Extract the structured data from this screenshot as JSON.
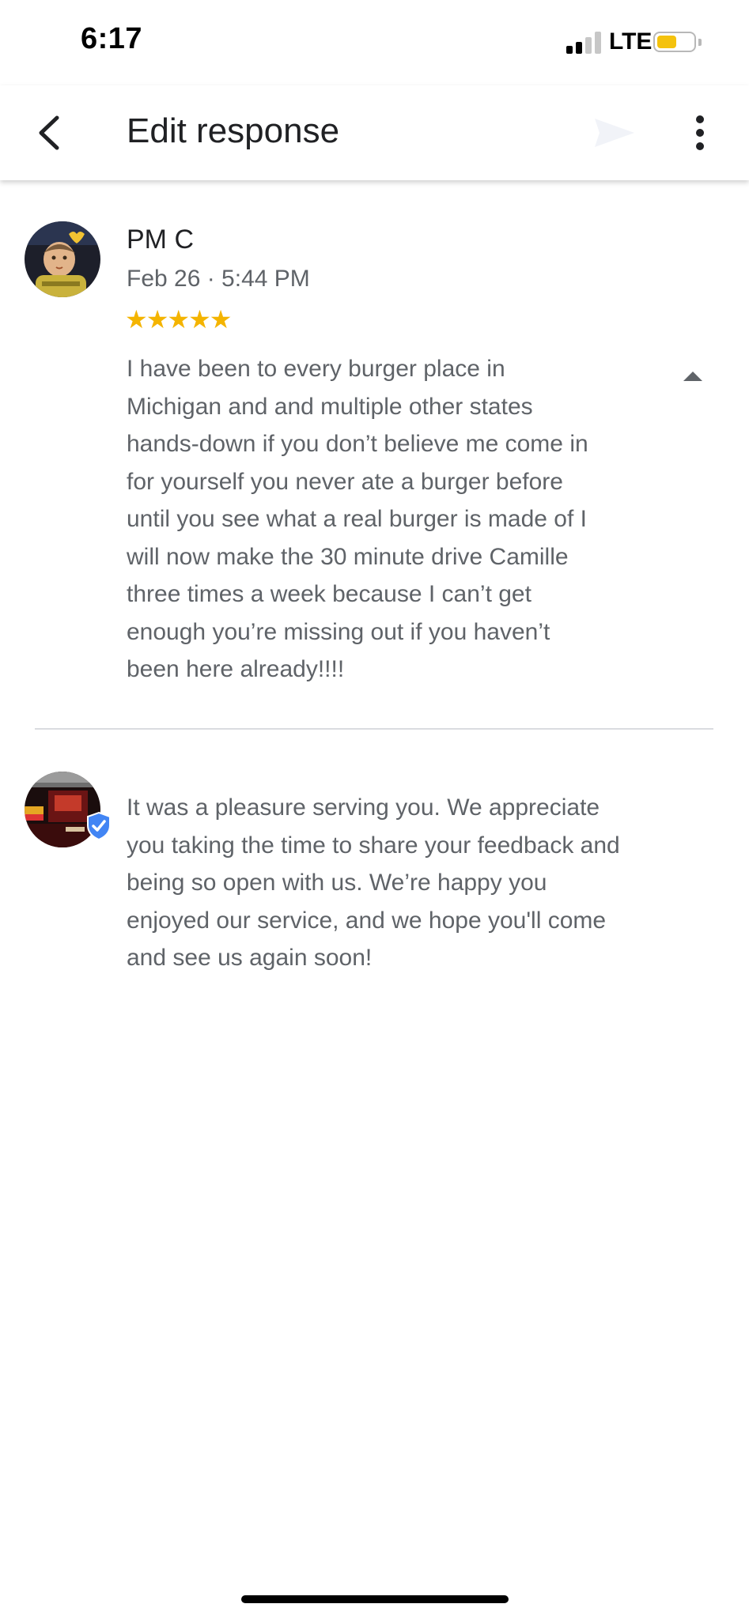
{
  "status_bar": {
    "time": "6:17",
    "network": "LTE",
    "battery_color": "#f4c20d",
    "battery_level": 0.55
  },
  "app_bar": {
    "title": "Edit response",
    "back_icon": "chevron-left-icon",
    "send_icon": "send-icon",
    "more_icon": "more-vert-icon"
  },
  "review": {
    "reviewer_name": "PM C",
    "date": "Feb 26 · 5:44 PM",
    "rating": 5,
    "stars": "★★★★★",
    "star_color": "#f4b400",
    "text_lines": [
      "I have been to every burger place in",
      "Michigan and and multiple other states",
      "hands-down if you don’t believe me come in",
      "for yourself you never ate a burger before",
      "until you see what a real burger is made of I",
      "will now make the 30 minute drive Camille",
      "three times a week because I can’t get",
      "enough you’re missing out if you haven’t",
      "been here already!!!!"
    ],
    "collapse_icon": "collapse-triangle-icon"
  },
  "response": {
    "text_lines": [
      "It was a pleasure serving you. We appreciate",
      "you taking the time to share your feedback and",
      "being so open with us. We’re happy you",
      "enjoyed our service, and we hope you'll come",
      "and see us again soon!"
    ],
    "verified_icon": "verified-check-icon",
    "verified_color": "#4285f4"
  }
}
